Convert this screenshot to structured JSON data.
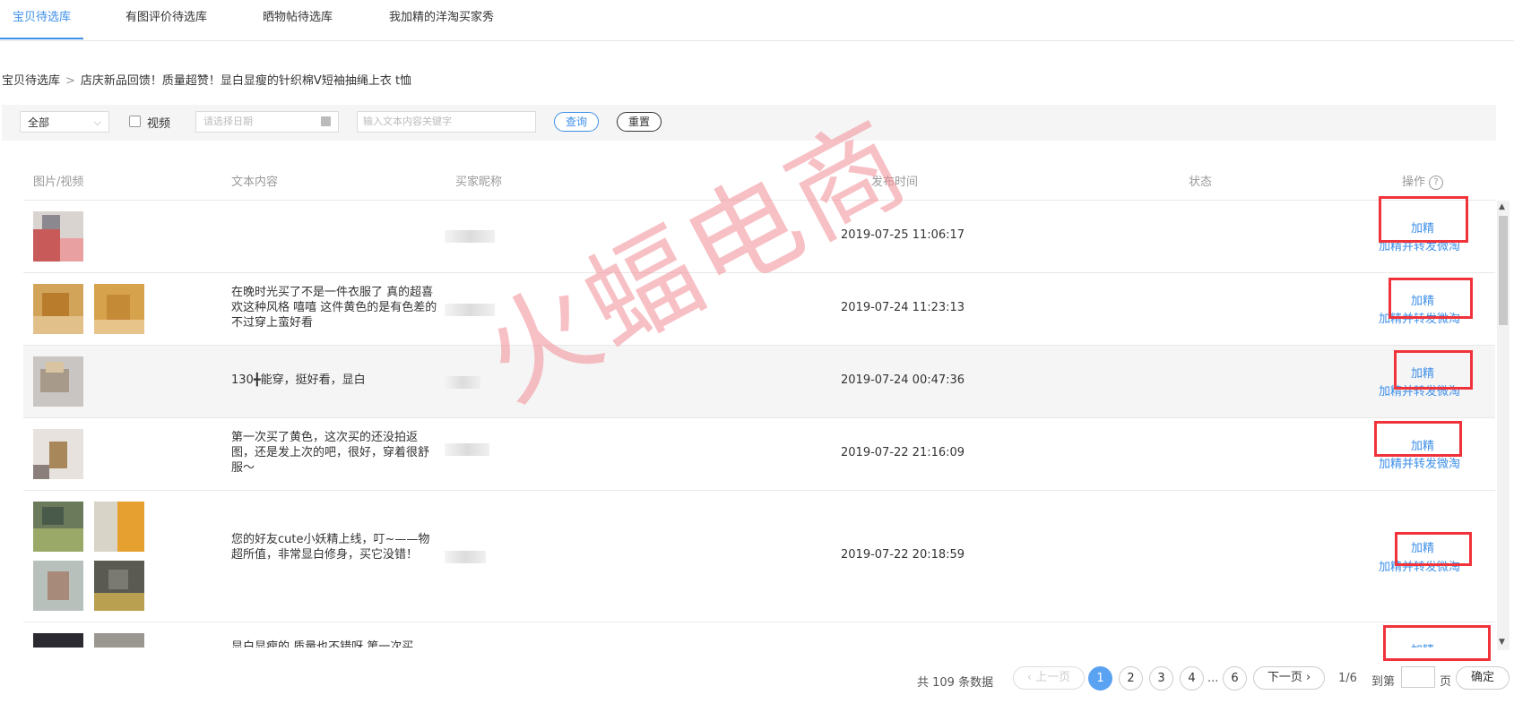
{
  "tabs": [
    {
      "label": "宝贝待选库",
      "active": true
    },
    {
      "label": "有图评价待选库"
    },
    {
      "label": "晒物帖待选库"
    },
    {
      "label": "我加精的洋淘买家秀"
    }
  ],
  "breadcrumb": {
    "root": "宝贝待选库",
    "sep": ">",
    "current": "店庆新品回馈！质量超赞！显白显瘦的针织棉V短袖抽绳上衣 t恤"
  },
  "filter": {
    "select_value": "全部",
    "video_label": "视频",
    "video_checked": false,
    "date_placeholder": "请选择日期",
    "keyword_placeholder": "输入文本内容关键字",
    "query_label": "查询",
    "reset_label": "重置"
  },
  "table": {
    "headers": {
      "media": "图片/视频",
      "text": "文本内容",
      "nickname": "买家昵称",
      "time": "发布时间",
      "status": "状态",
      "action": "操作"
    },
    "help_icon": "?",
    "rows": [
      {
        "text": "",
        "time": "2019-07-25 11:06:17",
        "action_primary": "加精",
        "action_secondary": "加精并转发微淘"
      },
      {
        "text": "在晚时光买了不是一件衣服了 真的超喜欢这种风格 嘻嘻 这件黄色的是有色差的 不过穿上蛮好看",
        "time": "2019-07-24 11:23:13",
        "action_primary": "加精",
        "action_secondary": "加精并转发微淘"
      },
      {
        "text": "130╋能穿，挺好看，显白",
        "time": "2019-07-24 00:47:36",
        "action_primary": "加精",
        "action_secondary": "加精并转发微淘"
      },
      {
        "text": "第一次买了黄色，这次买的还没拍返图，还是发上次的吧，很好，穿着很舒服～",
        "time": "2019-07-22 21:16:09",
        "action_primary": "加精",
        "action_secondary": "加精并转发微淘"
      },
      {
        "text": "您的好友cute小妖精上线，叮~——物超所值，非常显白修身，买它没错！",
        "time": "2019-07-22 20:18:59",
        "action_primary": "加精",
        "action_secondary": "加精并转发微淘"
      },
      {
        "text": "显白显瘦的 质量也不错呀 第一次买",
        "time": "",
        "action_primary": "加精",
        "action_secondary": ""
      }
    ]
  },
  "pagination": {
    "total": "共 109 条数据",
    "prev": "上一页",
    "pages": [
      "1",
      "2",
      "3",
      "4"
    ],
    "ellipsis": "...",
    "last_page": "6",
    "current": 1,
    "next": "下一页",
    "page_info": "1/6",
    "goto_prefix": "到第",
    "goto_suffix": "页",
    "confirm": "确定"
  },
  "watermark": "火蝠电商",
  "colors": {
    "accent": "#3d8fe8",
    "highlight_box": "#f0333a",
    "watermark": "#f08c96",
    "active_page": "#5aa2f2"
  }
}
